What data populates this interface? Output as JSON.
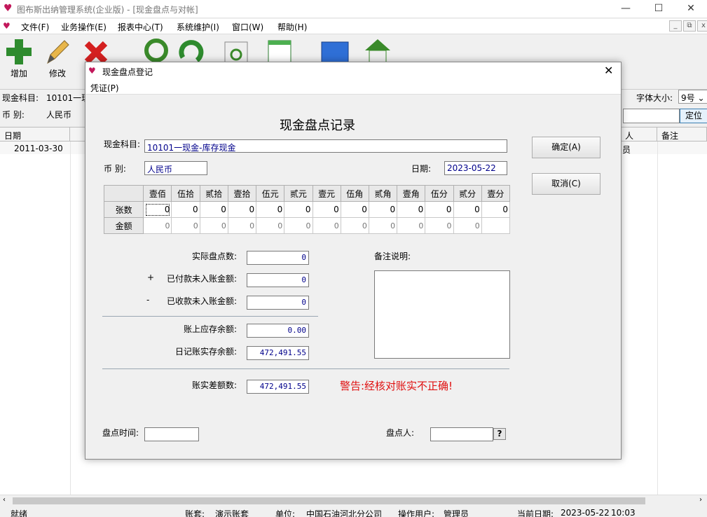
{
  "app": {
    "title": "图布斯出纳管理系统(企业版) - [现金盘点与对帐]"
  },
  "menu": [
    "文件(F)",
    "业务操作(E)",
    "报表中心(T)",
    "系统维护(I)",
    "窗口(W)",
    "帮助(H)"
  ],
  "toolbar": {
    "add": "增加",
    "edit": "修改"
  },
  "background": {
    "account_label": "现金科目:",
    "account_value": "10101一现",
    "currency_label": "币    别:",
    "currency_value": "人民币",
    "font_size_label": "字体大小:",
    "font_size_value": "9号",
    "locate_button": "定位",
    "columns": {
      "date": "日期",
      "person": "人",
      "remark": "备注"
    },
    "row": {
      "date": "2011-03-30",
      "person": "员"
    }
  },
  "dialog": {
    "title": "现金盘点登记",
    "menu": "凭证(P)",
    "heading": "现金盘点记录",
    "account_label": "现金科目:",
    "account_value": "10101一现金-库存现金",
    "currency_label": "币    别:",
    "currency_value": "人民币",
    "date_label": "日期:",
    "date_value": "2023-05-22",
    "ok_button": "确定(A)",
    "cancel_button": "取消(C)",
    "denominations": [
      "壹佰",
      "伍拾",
      "贰拾",
      "壹拾",
      "伍元",
      "贰元",
      "壹元",
      "伍角",
      "贰角",
      "壹角",
      "伍分",
      "贰分",
      "壹分"
    ],
    "count_label": "张数",
    "amount_label": "金额",
    "counts": [
      "0",
      "0",
      "0",
      "0",
      "0",
      "0",
      "0",
      "0",
      "0",
      "0",
      "0",
      "0",
      "0"
    ],
    "amounts": [
      "0",
      "0",
      "0",
      "0",
      "0",
      "0",
      "0",
      "0",
      "0",
      "0",
      "0",
      "0",
      ""
    ],
    "actual_label": "实际盘点数:",
    "actual_value": "0",
    "plus": "+",
    "paid_label": "已付款未入账金额:",
    "paid_value": "0",
    "minus": "-",
    "received_label": "已收款未入账金额:",
    "received_value": "0",
    "book_label": "账上应存余额:",
    "book_value": "0.00",
    "journal_label": "日记账实存余额:",
    "journal_value": "472,491.55",
    "diff_label": "账实差额数:",
    "diff_value": "472,491.55",
    "warning": "警告:经核对账实不正确!",
    "remark_label": "备注说明:",
    "time_label": "盘点时间:",
    "time_value": "",
    "person_label": "盘点人:",
    "person_value": "",
    "help_button": "?"
  },
  "status": {
    "ready": "就绪",
    "book_label": "账套:",
    "book_value": "演示账套",
    "unit_label": "单位:",
    "unit_value": "中国石油河北分公司",
    "user_label": "操作用户:",
    "user_value": "管理员",
    "date_label": "当前日期:",
    "date_value": "2023-05-22",
    "time_value": "10:03"
  },
  "colors": {
    "warning": "#e01010",
    "field_text": "#00008b",
    "add_icon": "#2e8b2e",
    "delete_icon": "#d42020",
    "search_icon": "#3a8a2a"
  }
}
